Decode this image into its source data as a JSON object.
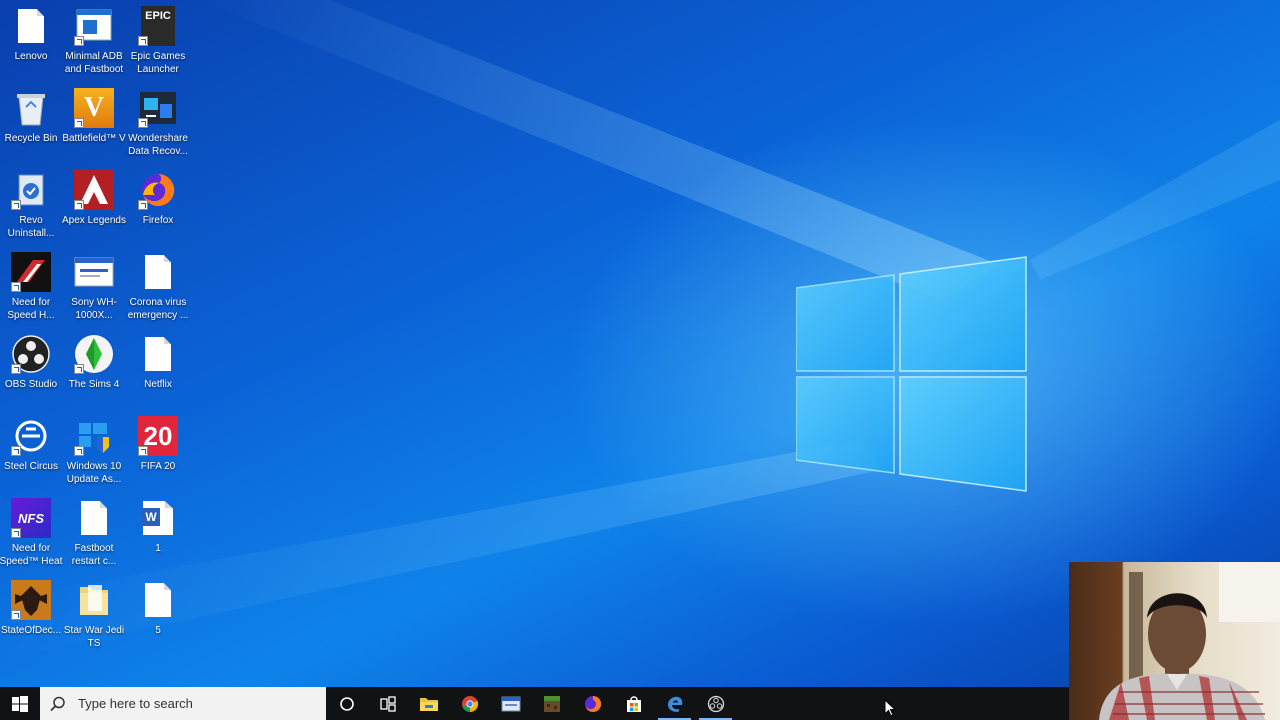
{
  "desktop_icons": [
    {
      "label": "Lenovo"
    },
    {
      "label": "Minimal ADB and Fastboot"
    },
    {
      "label": "Epic Games Launcher"
    },
    {
      "label": "Recycle Bin"
    },
    {
      "label": "Battlefield™ V"
    },
    {
      "label": "Wondershare Data Recov..."
    },
    {
      "label": "Revo Uninstall..."
    },
    {
      "label": "Apex Legends"
    },
    {
      "label": "Firefox"
    },
    {
      "label": "Need for Speed H..."
    },
    {
      "label": "Sony WH-1000X..."
    },
    {
      "label": "Corona virus emergency ..."
    },
    {
      "label": "OBS Studio"
    },
    {
      "label": "The Sims 4"
    },
    {
      "label": "Netflix"
    },
    {
      "label": "Steel Circus"
    },
    {
      "label": "Windows 10 Update As..."
    },
    {
      "label": "FIFA 20"
    },
    {
      "label": "Need for Speed™ Heat"
    },
    {
      "label": "Fastboot restart c..."
    },
    {
      "label": "1"
    },
    {
      "label": "StateOfDec..."
    },
    {
      "label": "Star War Jedi TS"
    },
    {
      "label": "5"
    }
  ],
  "icon_glyphs": {
    "epic": "EPIC",
    "battlefield": "V",
    "fifa": "20",
    "nfs": "NFS",
    "word": "W"
  },
  "taskbar": {
    "search_placeholder": "Type here to search",
    "apps": [
      "cortana-icon",
      "task-view-icon",
      "file-explorer-icon",
      "chrome-icon",
      "app-icon",
      "minecraft-icon",
      "firefox-icon",
      "store-icon",
      "edge-icon",
      "obs-icon"
    ]
  },
  "colors": {
    "wallpaper": "#0b63d6",
    "taskbar": "#101214",
    "accent": "#7fb8f0"
  }
}
